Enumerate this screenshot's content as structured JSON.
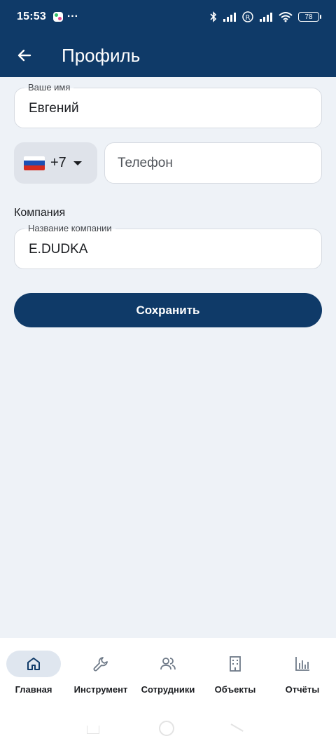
{
  "status": {
    "time": "15:53",
    "more": "···",
    "battery": "78"
  },
  "header": {
    "title": "Профиль"
  },
  "form": {
    "name": {
      "label": "Ваше имя",
      "value": "Евгений"
    },
    "country": {
      "code": "+7"
    },
    "phone": {
      "placeholder": "Телефон"
    },
    "company_section": "Компания",
    "company": {
      "label": "Название компании",
      "value": "E.DUDKA"
    },
    "save_label": "Сохранить"
  },
  "nav": {
    "items": [
      {
        "label": "Главная",
        "icon": "home-icon",
        "active": true
      },
      {
        "label": "Инструмент",
        "icon": "wrench-icon"
      },
      {
        "label": "Сотрудники",
        "icon": "people-icon"
      },
      {
        "label": "Объекты",
        "icon": "building-icon"
      },
      {
        "label": "Отчёты",
        "icon": "bar-chart-icon"
      }
    ]
  },
  "colors": {
    "primary": "#0f3a68",
    "background": "#eef2f7",
    "active_nav": "#dfe6ef"
  }
}
